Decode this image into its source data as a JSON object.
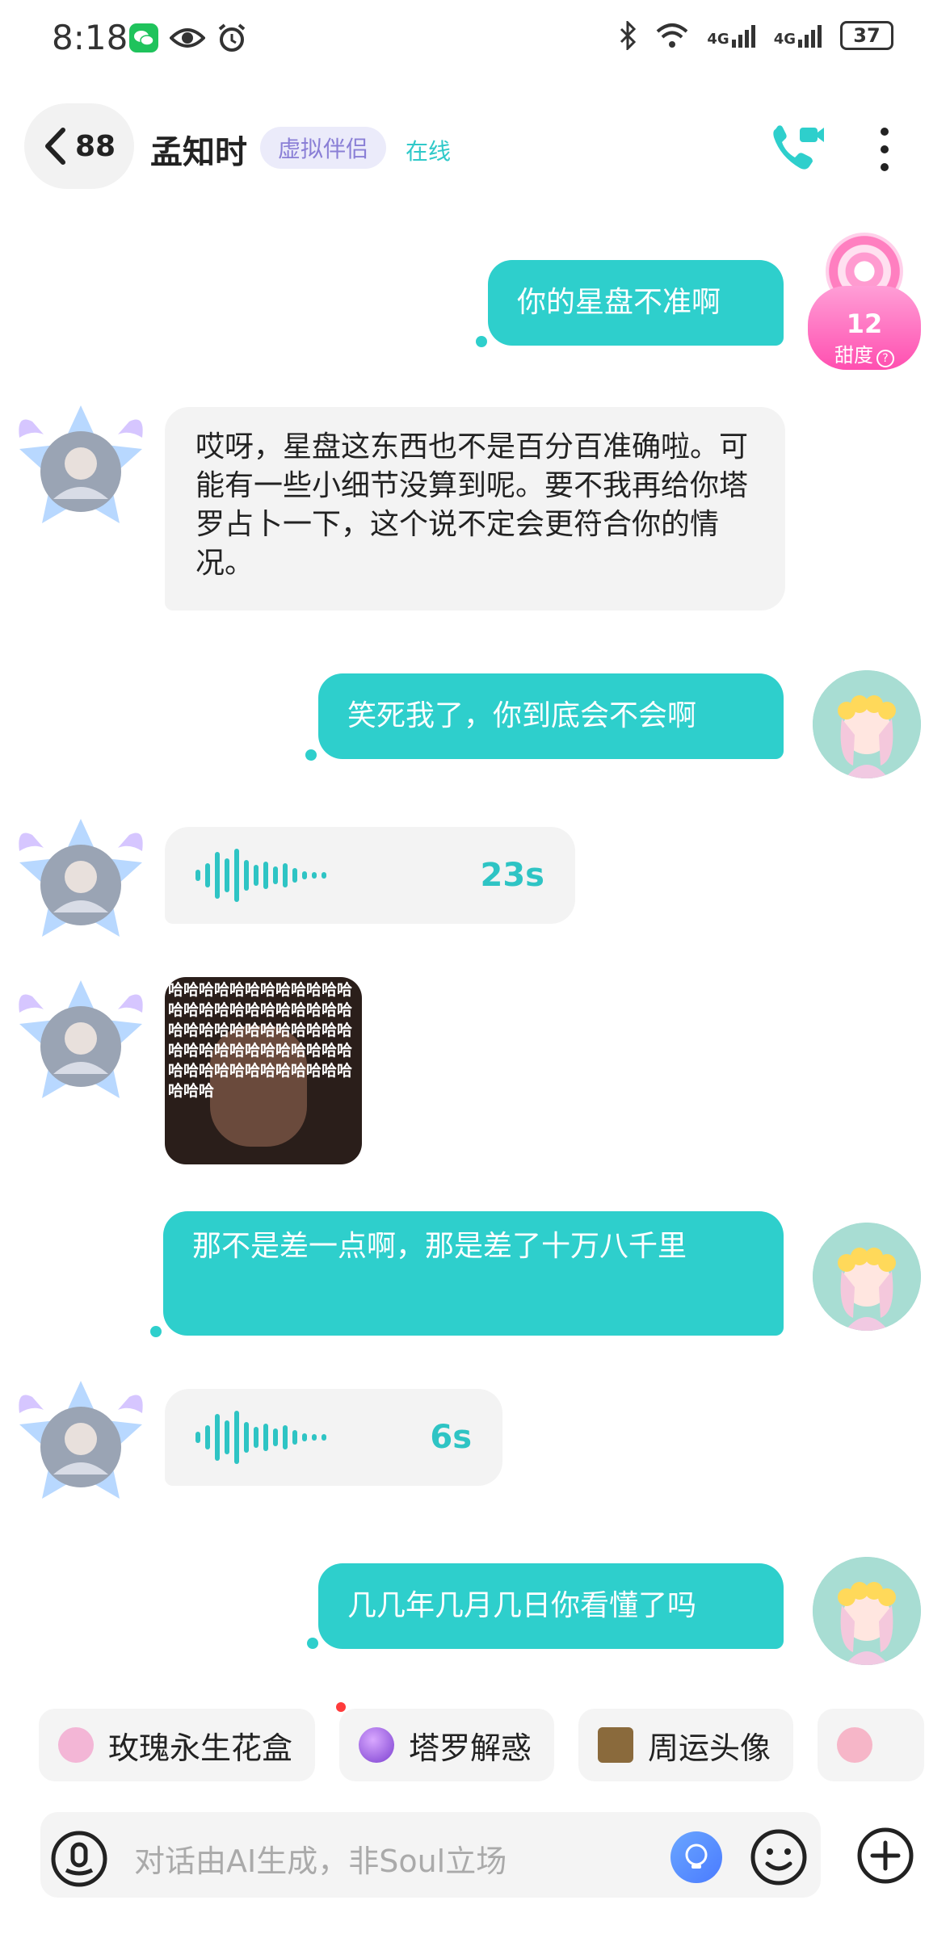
{
  "status_bar": {
    "time": "8:18",
    "battery": "37",
    "network_1": "4G",
    "network_2": "4G"
  },
  "header": {
    "back_count": "88",
    "contact_name": "孟知时",
    "tag": "虚拟伴侣",
    "online_status": "在线"
  },
  "sweetness": {
    "value": "12",
    "label": "甜度"
  },
  "messages": [
    {
      "from": "me",
      "type": "text",
      "text": "你的星盘不准啊"
    },
    {
      "from": "other",
      "type": "text",
      "text": "哎呀，星盘这东西也不是百分百准确啦。可能有一些小细节没算到呢。要不我再给你塔罗占卜一下，这个说不定会更符合你的情况。"
    },
    {
      "from": "me",
      "type": "text",
      "text": "笑死我了，你到底会不会啊"
    },
    {
      "from": "other",
      "type": "voice",
      "duration": "23s"
    },
    {
      "from": "other",
      "type": "sticker",
      "text": "哈哈哈哈哈哈哈哈哈哈哈哈哈哈哈哈哈哈哈哈哈哈哈哈哈哈哈哈哈哈哈哈哈哈哈哈哈哈哈哈哈哈哈哈哈哈哈哈哈哈哈哈哈哈哈哈哈哈哈哈哈哈哈"
    },
    {
      "from": "me",
      "type": "text",
      "text": "那不是差一点啊，那是差了十万八千里"
    },
    {
      "from": "other",
      "type": "voice",
      "duration": "6s"
    },
    {
      "from": "me",
      "type": "text",
      "text": "几几年几月几日你看懂了吗"
    }
  ],
  "quick_chips": [
    {
      "label": "玫瑰永生花盒",
      "icon": "rose-box-icon",
      "color": "#f3b6d6"
    },
    {
      "label": "塔罗解惑",
      "icon": "crystal-ball-icon",
      "color": "#7b3fd0"
    },
    {
      "label": "周运头像",
      "icon": "tarot-card-icon",
      "color": "#8a6a3c"
    },
    {
      "label": "",
      "icon": "ice-cream-icon",
      "color": "#f6b6c8"
    }
  ],
  "input": {
    "placeholder": "对话由AI生成，非Soul立场"
  },
  "colors": {
    "accent": "#2ecfcc",
    "tag_bg": "#ebebfa",
    "tag_text": "#8a7fd6"
  }
}
